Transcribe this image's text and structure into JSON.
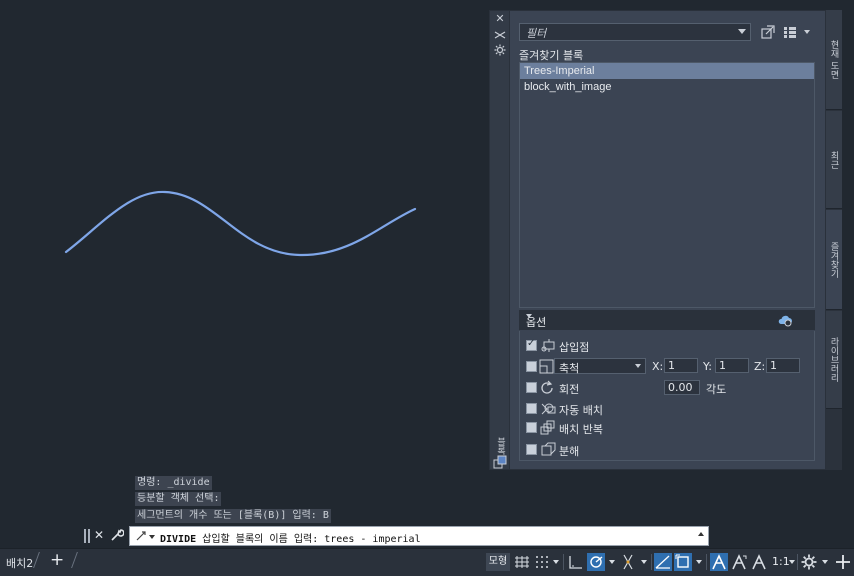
{
  "drawing": {
    "curve_color": "#7fa6e8"
  },
  "palette": {
    "bar_title": "블록",
    "filter_placeholder": "필터",
    "favorites_title": "즐겨찾기 블록",
    "blocks": [
      "Trees-Imperial",
      "block_with_image"
    ],
    "selected_block": "Trees-Imperial",
    "options_title": "옵션",
    "options": {
      "insertion_point": "삽입점",
      "scale_value": "축척",
      "x_label": "X:",
      "x_value": "1",
      "y_label": "Y:",
      "y_value": "1",
      "z_label": "Z:",
      "z_value": "1",
      "rotation": "회전",
      "angle_value": "0.00",
      "angle_label": "각도",
      "auto_place": "자동 배치",
      "repeat_place": "배치 반복",
      "explode": "분해"
    },
    "tabs": [
      "현재 도면",
      "최근",
      "즐겨찾기",
      "라이브러리"
    ]
  },
  "history": [
    "명령: _divide",
    "등분할 객체 선택:",
    "세그먼트의 개수 또는 [블록(B)] 입력: B"
  ],
  "command": {
    "name": "DIVIDE",
    "prompt": "삽입할 블록의 이름 입력: trees - imperial"
  },
  "statusbar": {
    "layout_tab": "배치2",
    "model": "모형",
    "scale": "1:1"
  },
  "colors": {
    "accent": "#2f6fb0",
    "background": "#212830",
    "panel": "#3b4453"
  }
}
